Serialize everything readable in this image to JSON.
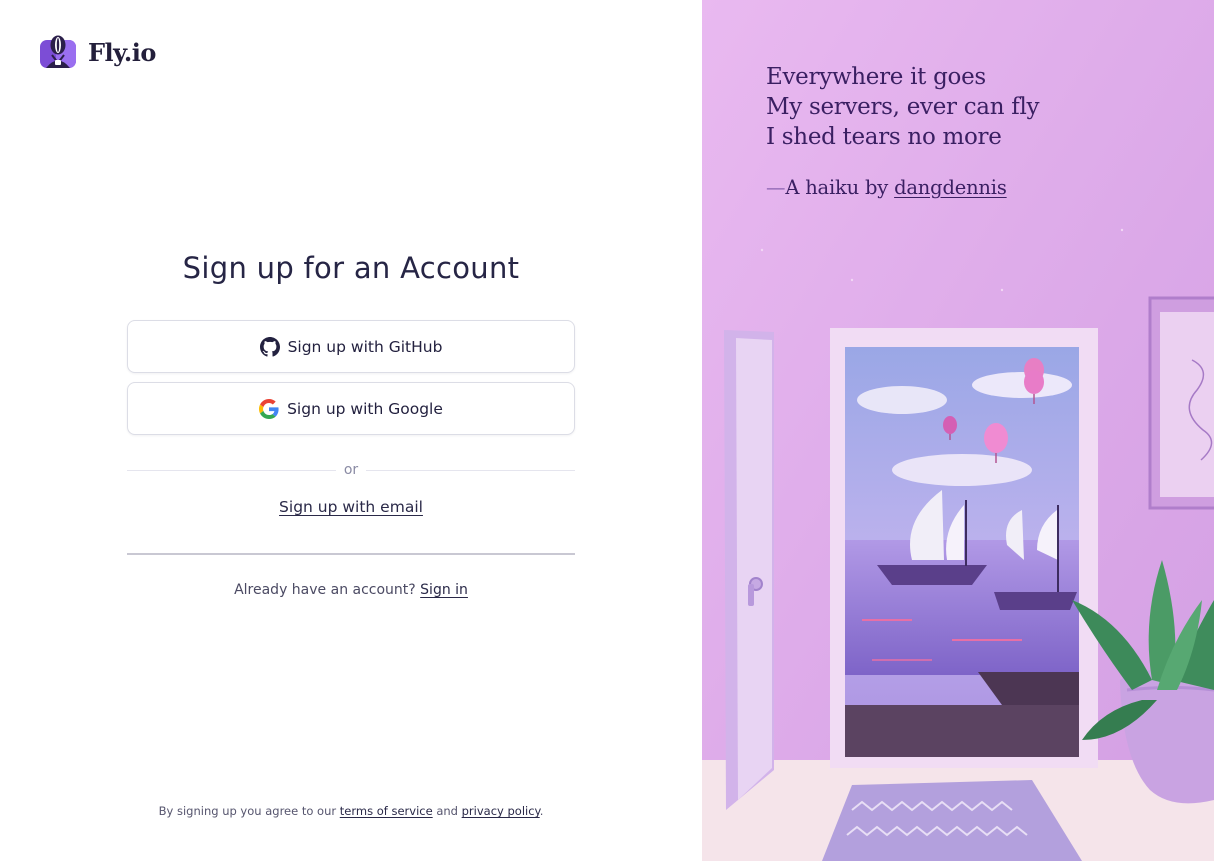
{
  "brand": {
    "name": "Fly.io"
  },
  "signup": {
    "title": "Sign up for an Account",
    "github_label": "Sign up with GitHub",
    "google_label": "Sign up with Google",
    "divider_text": "or",
    "email_label": "Sign up with email",
    "have_account_text": "Already have an account?",
    "signin_label": "Sign in"
  },
  "legal": {
    "prefix": "By signing up you agree to our",
    "terms_label": "terms of service",
    "conjunction": "and",
    "privacy_label": "privacy policy",
    "suffix": "."
  },
  "haiku": {
    "lines": [
      "Everywhere it goes",
      "My servers, ever can fly",
      "I shed tears no more"
    ],
    "credit_dash": "—",
    "credit_prefix": "A haiku by",
    "author": "dangdennis"
  },
  "colors": {
    "accent_purple": "#7c4dd6",
    "panel_bg": "#e2b2ec",
    "text_dark": "#23213f"
  }
}
